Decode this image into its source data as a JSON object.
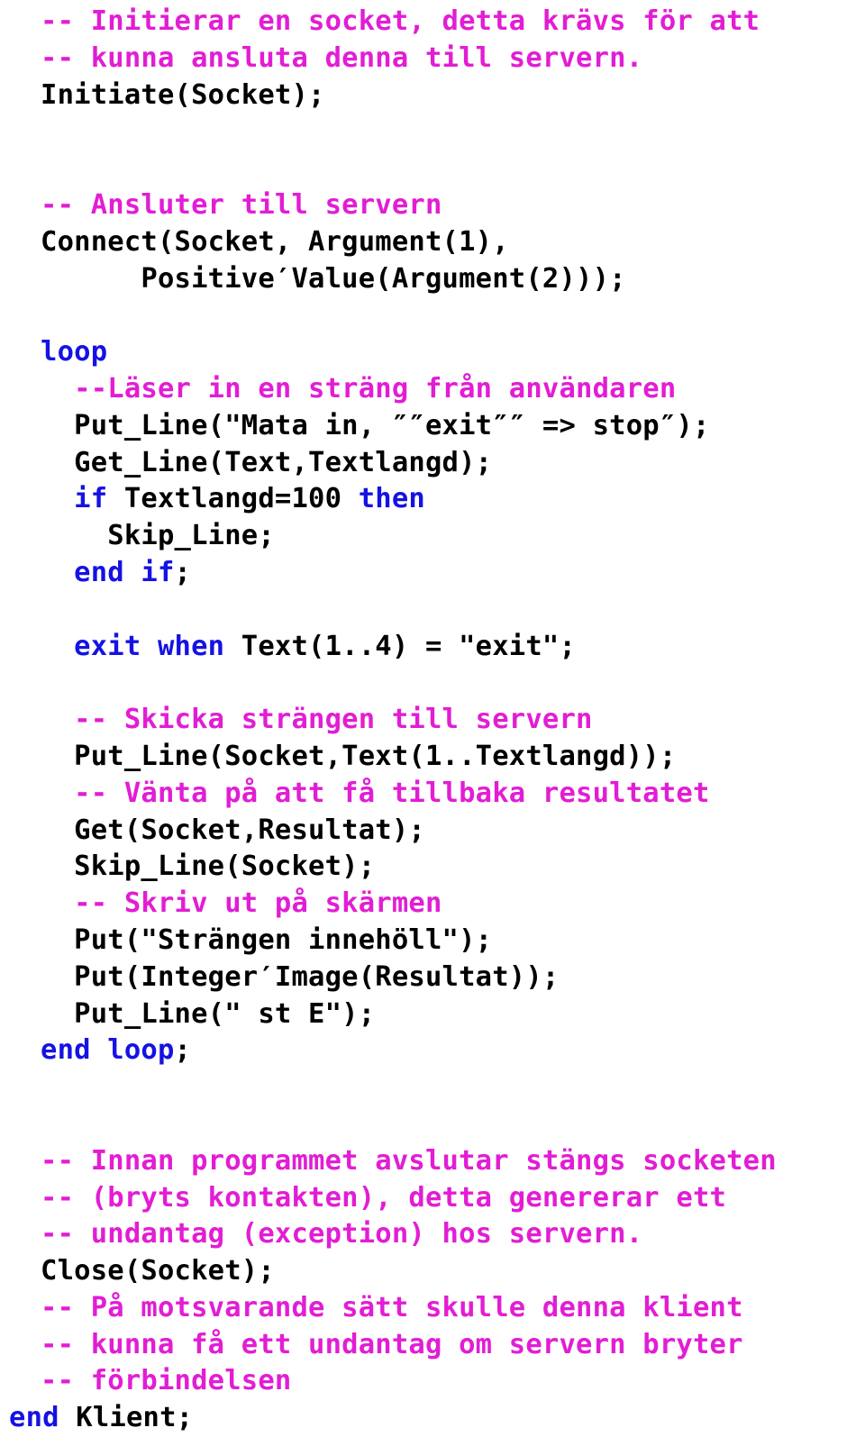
{
  "document": {
    "kind": "source-code-listing",
    "language": "Ada",
    "colors": {
      "comment": "#E21DD4",
      "keyword": "#1512E3",
      "plain": "#000000",
      "background": "#FFFFFF"
    }
  },
  "lines": [
    {
      "id": "line-1",
      "indent": 45,
      "segments": [
        {
          "style": "comment",
          "text": "-- Initierar en socket, detta krävs för att"
        }
      ]
    },
    {
      "id": "line-2",
      "indent": 45,
      "segments": [
        {
          "style": "comment",
          "text": "-- kunna ansluta denna till servern."
        }
      ]
    },
    {
      "id": "line-3",
      "indent": 45,
      "segments": [
        {
          "style": "plain",
          "text": "Initiate(Socket);"
        }
      ]
    },
    {
      "id": "line-4",
      "indent": 45,
      "segments": [
        {
          "style": "plain",
          "text": ""
        }
      ]
    },
    {
      "id": "line-5",
      "indent": 45,
      "segments": [
        {
          "style": "plain",
          "text": ""
        }
      ]
    },
    {
      "id": "line-6",
      "indent": 45,
      "segments": [
        {
          "style": "comment",
          "text": "-- Ansluter till servern"
        }
      ]
    },
    {
      "id": "line-7",
      "indent": 45,
      "segments": [
        {
          "style": "plain",
          "text": "Connect(Socket, Argument(1),"
        }
      ]
    },
    {
      "id": "line-8",
      "indent": 45,
      "segments": [
        {
          "style": "plain",
          "text": "      Positive′Value(Argument(2)));"
        }
      ]
    },
    {
      "id": "line-9",
      "indent": 45,
      "segments": [
        {
          "style": "plain",
          "text": ""
        }
      ]
    },
    {
      "id": "line-10",
      "indent": 45,
      "segments": [
        {
          "style": "keyword",
          "text": "loop"
        }
      ]
    },
    {
      "id": "line-11",
      "indent": 45,
      "segments": [
        {
          "style": "comment",
          "text": "  --Läser in en sträng från användaren"
        }
      ]
    },
    {
      "id": "line-12",
      "indent": 45,
      "segments": [
        {
          "style": "plain",
          "text": "  Put_Line(\"Mata in, ″″exit″″ => stop″);"
        }
      ]
    },
    {
      "id": "line-13",
      "indent": 45,
      "segments": [
        {
          "style": "plain",
          "text": "  Get_Line(Text,Textlangd);"
        }
      ]
    },
    {
      "id": "line-14",
      "indent": 45,
      "segments": [
        {
          "style": "keyword",
          "text": "  if"
        },
        {
          "style": "plain",
          "text": " Textlangd=100 "
        },
        {
          "style": "keyword",
          "text": "then"
        }
      ]
    },
    {
      "id": "line-15",
      "indent": 45,
      "segments": [
        {
          "style": "plain",
          "text": "    Skip_Line;"
        }
      ]
    },
    {
      "id": "line-16",
      "indent": 45,
      "segments": [
        {
          "style": "keyword",
          "text": "  end if"
        },
        {
          "style": "plain",
          "text": ";"
        }
      ]
    },
    {
      "id": "line-17",
      "indent": 45,
      "segments": [
        {
          "style": "plain",
          "text": ""
        }
      ]
    },
    {
      "id": "line-18",
      "indent": 45,
      "segments": [
        {
          "style": "keyword",
          "text": "  exit when"
        },
        {
          "style": "plain",
          "text": " Text(1..4) = \"exit\";"
        }
      ]
    },
    {
      "id": "line-19",
      "indent": 45,
      "segments": [
        {
          "style": "plain",
          "text": ""
        }
      ]
    },
    {
      "id": "line-20",
      "indent": 45,
      "segments": [
        {
          "style": "comment",
          "text": "  -- Skicka strängen till servern"
        }
      ]
    },
    {
      "id": "line-21",
      "indent": 45,
      "segments": [
        {
          "style": "plain",
          "text": "  Put_Line(Socket,Text(1..Textlangd));"
        }
      ]
    },
    {
      "id": "line-22",
      "indent": 45,
      "segments": [
        {
          "style": "comment",
          "text": "  -- Vänta på att få tillbaka resultatet"
        }
      ]
    },
    {
      "id": "line-23",
      "indent": 45,
      "segments": [
        {
          "style": "plain",
          "text": "  Get(Socket,Resultat);"
        }
      ]
    },
    {
      "id": "line-24",
      "indent": 45,
      "segments": [
        {
          "style": "plain",
          "text": "  Skip_Line(Socket);"
        }
      ]
    },
    {
      "id": "line-25",
      "indent": 45,
      "segments": [
        {
          "style": "comment",
          "text": "  -- Skriv ut på skärmen"
        }
      ]
    },
    {
      "id": "line-26",
      "indent": 45,
      "segments": [
        {
          "style": "plain",
          "text": "  Put(\"Strängen innehöll\");"
        }
      ]
    },
    {
      "id": "line-27",
      "indent": 45,
      "segments": [
        {
          "style": "plain",
          "text": "  Put(Integer′Image(Resultat));"
        }
      ]
    },
    {
      "id": "line-28",
      "indent": 45,
      "segments": [
        {
          "style": "plain",
          "text": "  Put_Line(\" st E\");"
        }
      ]
    },
    {
      "id": "line-29",
      "indent": 45,
      "segments": [
        {
          "style": "keyword",
          "text": "end loop"
        },
        {
          "style": "plain",
          "text": ";"
        }
      ]
    },
    {
      "id": "line-30",
      "indent": 45,
      "segments": [
        {
          "style": "plain",
          "text": ""
        }
      ]
    },
    {
      "id": "line-31",
      "indent": 45,
      "segments": [
        {
          "style": "plain",
          "text": ""
        }
      ]
    },
    {
      "id": "line-32",
      "indent": 45,
      "segments": [
        {
          "style": "comment",
          "text": "-- Innan programmet avslutar stängs socketen"
        }
      ]
    },
    {
      "id": "line-33",
      "indent": 45,
      "segments": [
        {
          "style": "comment",
          "text": "-- (bryts kontakten), detta genererar ett"
        }
      ]
    },
    {
      "id": "line-34",
      "indent": 45,
      "segments": [
        {
          "style": "comment",
          "text": "-- undantag (exception) hos servern."
        }
      ]
    },
    {
      "id": "line-35",
      "indent": 45,
      "segments": [
        {
          "style": "plain",
          "text": "Close(Socket);"
        }
      ]
    },
    {
      "id": "line-36",
      "indent": 45,
      "segments": [
        {
          "style": "comment",
          "text": "-- På motsvarande sätt skulle denna klient"
        }
      ]
    },
    {
      "id": "line-37",
      "indent": 45,
      "segments": [
        {
          "style": "comment",
          "text": "-- kunna få ett undantag om servern bryter"
        }
      ]
    },
    {
      "id": "line-38",
      "indent": 45,
      "segments": [
        {
          "style": "comment",
          "text": "-- förbindelsen"
        }
      ]
    },
    {
      "id": "line-39",
      "indent": 10,
      "segments": [
        {
          "style": "keyword",
          "text": "end"
        },
        {
          "style": "plain",
          "text": " Klient;"
        }
      ]
    }
  ]
}
